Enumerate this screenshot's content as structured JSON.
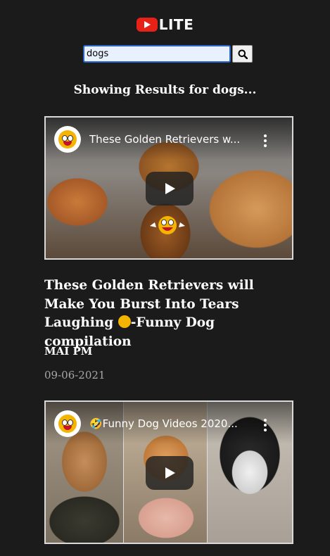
{
  "header": {
    "logo_text": "LITE",
    "logo_icon": "youtube-play-icon",
    "accent_color": "#e62117"
  },
  "search": {
    "value": "dogs",
    "button_icon": "search-icon"
  },
  "results_heading": "Showing Results for dogs...",
  "videos": [
    {
      "overlay_title": "These Golden Retrievers w...",
      "title": "These Golden Retrievers will Make You Burst Into Tears Laughing",
      "title_suffix": "-Funny Dog compilation",
      "channel": "MAI PM",
      "date": "09-06-2021"
    },
    {
      "overlay_title": "🤣Funny Dog Videos 2020...",
      "title": "",
      "channel": "",
      "date": ""
    }
  ]
}
